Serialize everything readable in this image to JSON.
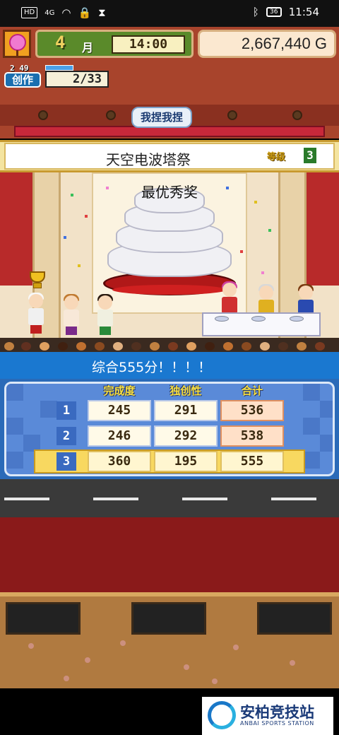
{
  "status_bar": {
    "hd": "HD",
    "net": "4G",
    "battery": "36",
    "time": "11:54"
  },
  "hud": {
    "month_number": "4",
    "month_unit": "月",
    "time": "14:00",
    "money": "2,667,440 G"
  },
  "creation": {
    "level_text": "2 49",
    "badge": "创作",
    "count": "2/33"
  },
  "pinch_button": "我捏我捏",
  "event": {
    "name": "天空电波塔祭",
    "rank_label": "等级",
    "rank_value": "3"
  },
  "award_text": "最优秀奖",
  "score_banner": "综合555分！！！！",
  "result_table": {
    "columns": [
      "完成度",
      "独创性",
      "合计"
    ],
    "rows": [
      {
        "rank": "1",
        "completion": "245",
        "originality": "291",
        "total": "536"
      },
      {
        "rank": "2",
        "completion": "246",
        "originality": "292",
        "total": "538"
      },
      {
        "rank": "3",
        "completion": "360",
        "originality": "195",
        "total": "555"
      }
    ]
  },
  "logo": {
    "title": "安柏竞技站",
    "subtitle": "ANBAI SPORTS STATION"
  },
  "colors": {
    "hud_green": "#5a8a2a",
    "banner_blue": "#1a78d0",
    "highlight_row": "#f8d860",
    "curtain_red": "#b82a2a"
  }
}
